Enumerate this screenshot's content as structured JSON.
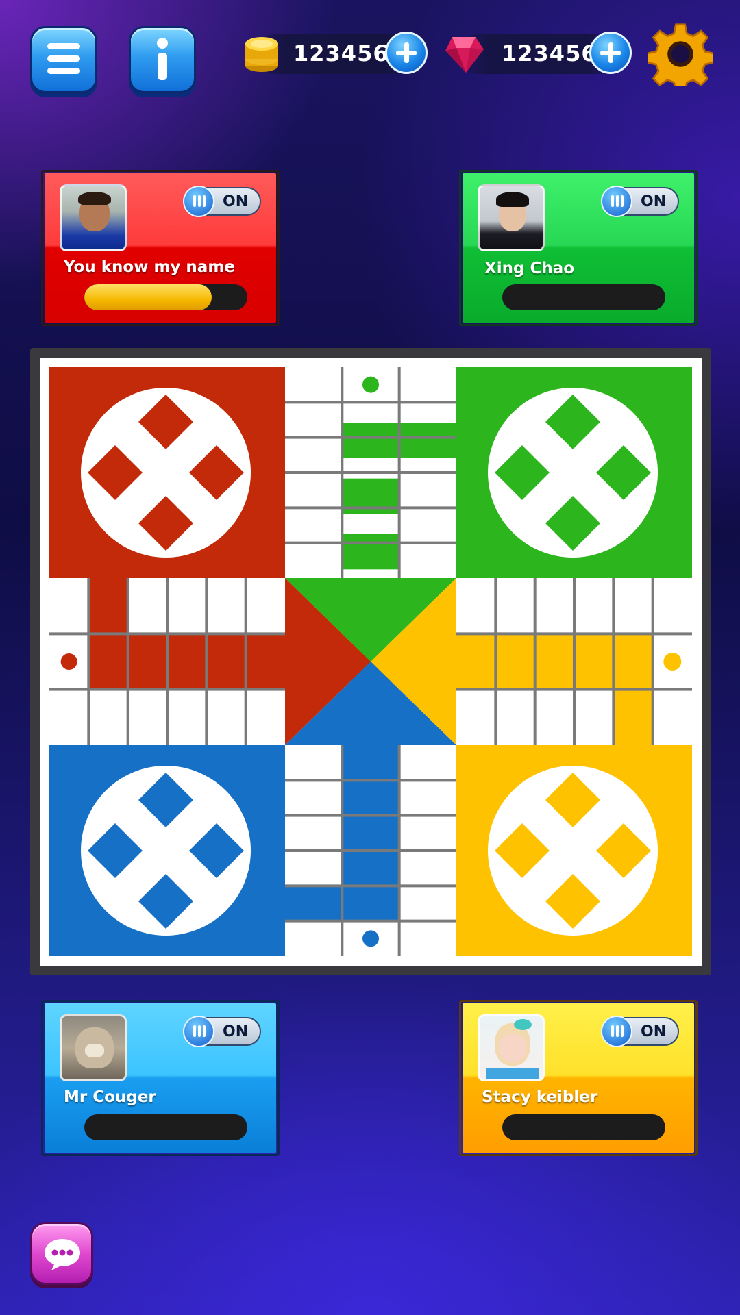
{
  "top_bar": {
    "menu_icon": "hamburger-menu-icon",
    "info_icon": "info-icon",
    "coins": {
      "icon": "gold-coins-icon",
      "value": "123456"
    },
    "gems": {
      "icon": "ruby-gem-icon",
      "value": "123456"
    },
    "settings_icon": "gear-icon"
  },
  "players": {
    "red": {
      "name": "You know my name",
      "toggle_label": "ON",
      "progress": 0.78,
      "color": "#e01010"
    },
    "green": {
      "name": "Xing Chao",
      "toggle_label": "ON",
      "progress": 0,
      "color": "#12c23a"
    },
    "blue": {
      "name": "Mr Couger",
      "toggle_label": "ON",
      "progress": 0,
      "color": "#1a9ef0"
    },
    "yellow": {
      "name": "Stacy keibler",
      "toggle_label": "ON",
      "progress": 0,
      "color": "#ffb000"
    }
  },
  "board": {
    "colors": {
      "red": "#c22a0a",
      "green": "#2db51e",
      "yellow": "#ffc200",
      "blue": "#1670c6",
      "grid": "#7a7a7a"
    }
  },
  "chat_icon": "chat-bubble-icon"
}
